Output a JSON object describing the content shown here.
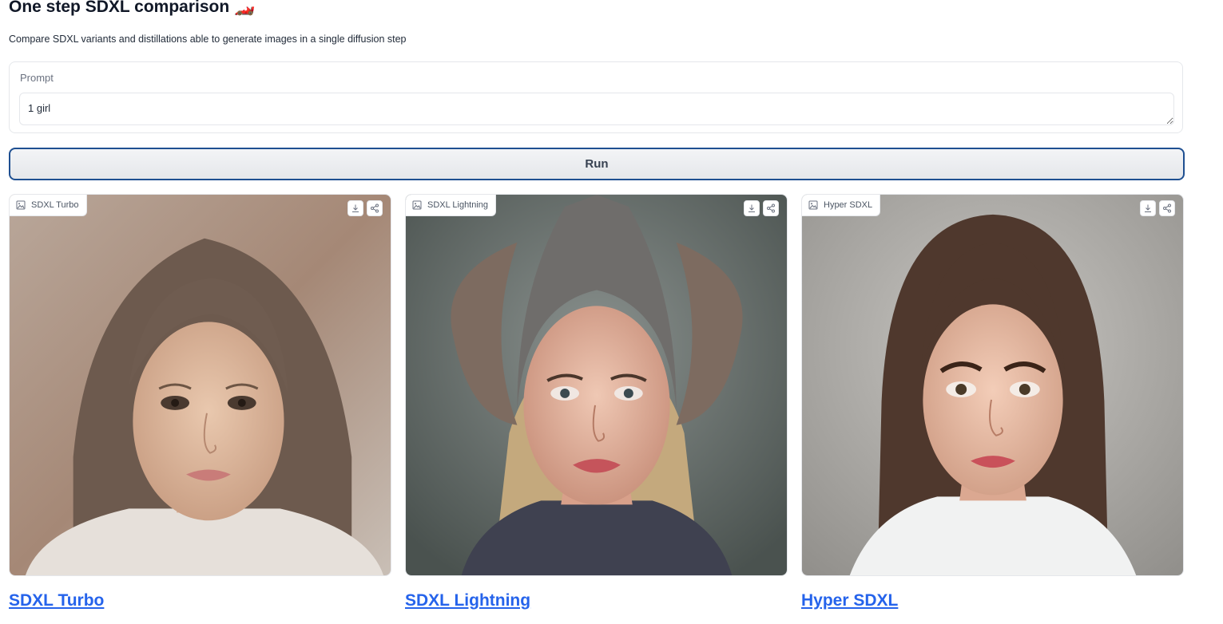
{
  "header": {
    "title": "One step SDXL comparison",
    "title_emoji": "🏎️",
    "subtitle": "Compare SDXL variants and distillations able to generate images in a single diffusion step"
  },
  "prompt": {
    "label": "Prompt",
    "value": "1 girl"
  },
  "run_button": {
    "label": "Run"
  },
  "panels": [
    {
      "label": "SDXL Turbo",
      "link": "SDXL Turbo"
    },
    {
      "label": "SDXL Lightning",
      "link": "SDXL Lightning"
    },
    {
      "label": "Hyper SDXL",
      "link": "Hyper SDXL"
    }
  ],
  "colors": {
    "accent_link": "#2563eb",
    "run_border": "#1e4f91",
    "border": "#e5e7eb"
  },
  "icons": [
    "image-icon",
    "download-icon",
    "share-icon"
  ]
}
